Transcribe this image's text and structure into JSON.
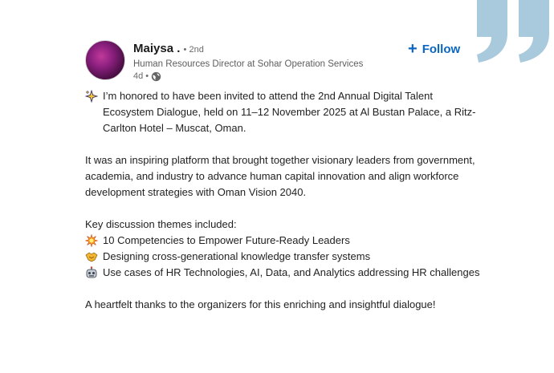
{
  "author": {
    "name": "Maiysa .",
    "degree": "• 2nd",
    "headline": "Human Resources Director at Sohar Operation Services",
    "time": "4d •"
  },
  "follow_label": "Follow",
  "post": {
    "intro": "I’m honored to have been invited to attend the 2nd Annual Digital Talent Ecosystem Dialogue, held on 11–12 November 2025 at Al Bustan Palace, a Ritz-Carlton Hotel – Muscat, Oman.",
    "para2": "It was an inspiring platform that brought together visionary leaders from government, academia, and industry to advance human capital innovation and align workforce development strategies with Oman Vision 2040.",
    "themes_heading": "Key discussion themes included:",
    "themes": [
      "10 Competencies to Empower Future-Ready Leaders",
      "Designing cross-generational knowledge transfer systems",
      "Use cases of HR Technologies, AI, Data, and Analytics addressing HR challenges"
    ],
    "closing": "A heartfelt thanks to the organizers for this enriching and insightful dialogue!"
  },
  "icons": {
    "intro": "sparkles-icon",
    "theme_1": "collision-icon",
    "theme_2": "handshake-icon",
    "theme_3": "robot-icon",
    "privacy": "globe-icon",
    "decoration": "quotation-mark-icon"
  },
  "colors": {
    "accent": "#0a66c2",
    "quote_decoration": "#a9c9dc"
  }
}
